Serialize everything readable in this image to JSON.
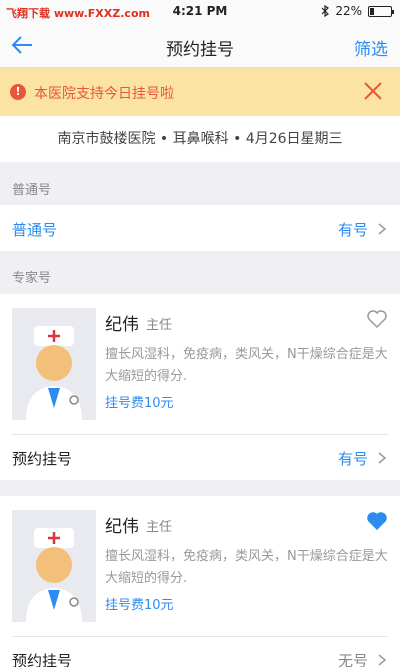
{
  "status": {
    "carrier": "飞翔下载 www.FXXZ.com",
    "time": "4:21 PM",
    "battery": "22%",
    "battery_level": 0.22
  },
  "nav": {
    "title": "预约挂号",
    "filter": "筛选"
  },
  "notice": {
    "text": "本医院支持今日挂号啦"
  },
  "info": {
    "line": "南京市鼓楼医院 • 耳鼻喉科 • 4月26日星期三"
  },
  "general": {
    "section": "普通号",
    "row_label": "普通号",
    "row_value": "有号"
  },
  "expert": {
    "section": "专家号"
  },
  "doctors": [
    {
      "name": "纪伟",
      "title": "主任",
      "desc": "擅长风湿科，免疫病，类风关，N干燥综合症是大大缩短的得分.",
      "fee": "挂号费10元",
      "favorited": false,
      "book_label": "预约挂号",
      "book_value": "有号"
    },
    {
      "name": "纪伟",
      "title": "主任",
      "desc": "擅长风湿科，免疫病，类风关，N干燥综合症是大大缩短的得分.",
      "fee": "挂号费10元",
      "favorited": true,
      "book_label": "预约挂号",
      "book_value": "无号"
    }
  ],
  "colors": {
    "accent": "#2d8cf0",
    "warning_bg": "#fbe3a4",
    "warning_text": "#e8573a"
  }
}
